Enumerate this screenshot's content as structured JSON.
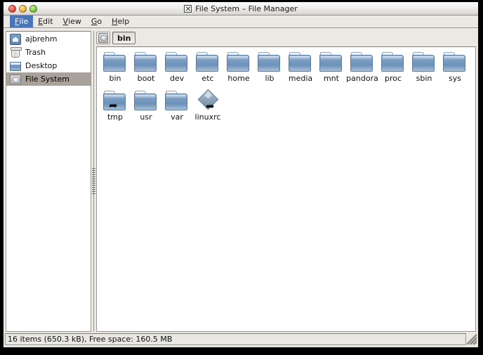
{
  "window": {
    "title": "File System – File Manager",
    "title_icon": "window-x-icon",
    "controls": [
      {
        "name": "close-button",
        "color": "#e2564b"
      },
      {
        "name": "minimize-button",
        "color": "#efb73f"
      },
      {
        "name": "maximize-button",
        "color": "#82c947"
      }
    ]
  },
  "menubar": {
    "items": [
      {
        "label": "File",
        "accel": "F",
        "active": true
      },
      {
        "label": "Edit",
        "accel": "E",
        "active": false
      },
      {
        "label": "View",
        "accel": "V",
        "active": false
      },
      {
        "label": "Go",
        "accel": "G",
        "active": false
      },
      {
        "label": "Help",
        "accel": "H",
        "active": false
      }
    ]
  },
  "sidebar": {
    "items": [
      {
        "label": "ajbrehm",
        "icon": "home-icon",
        "selected": false
      },
      {
        "label": "Trash",
        "icon": "trash-icon",
        "selected": false
      },
      {
        "label": "Desktop",
        "icon": "desktop-icon",
        "selected": false
      },
      {
        "label": "File System",
        "icon": "drive-icon",
        "selected": true
      }
    ]
  },
  "pathbar": {
    "root_icon": "drive-icon",
    "crumbs": [
      {
        "label": "bin",
        "current": true
      }
    ]
  },
  "files": [
    {
      "name": "bin",
      "type": "folder",
      "symlink": false
    },
    {
      "name": "boot",
      "type": "folder",
      "symlink": false
    },
    {
      "name": "dev",
      "type": "folder",
      "symlink": false
    },
    {
      "name": "etc",
      "type": "folder",
      "symlink": false
    },
    {
      "name": "home",
      "type": "folder",
      "symlink": false
    },
    {
      "name": "lib",
      "type": "folder",
      "symlink": false
    },
    {
      "name": "media",
      "type": "folder",
      "symlink": false
    },
    {
      "name": "mnt",
      "type": "folder",
      "symlink": false
    },
    {
      "name": "pandora",
      "type": "folder",
      "symlink": false
    },
    {
      "name": "proc",
      "type": "folder",
      "symlink": false
    },
    {
      "name": "sbin",
      "type": "folder",
      "symlink": false
    },
    {
      "name": "sys",
      "type": "folder",
      "symlink": false
    },
    {
      "name": "tmp",
      "type": "folder",
      "symlink": true
    },
    {
      "name": "usr",
      "type": "folder",
      "symlink": false
    },
    {
      "name": "var",
      "type": "folder",
      "symlink": false
    },
    {
      "name": "linuxrc",
      "type": "symlink",
      "symlink": true
    }
  ],
  "statusbar": {
    "text": "16 items (650.3 kB), Free space: 160.5 MB"
  },
  "colors": {
    "menu_highlight": "#4a76b8",
    "selection": "#a8a29a",
    "folder_blue": "#7fa0c4",
    "window_bg": "#ece9e4"
  }
}
